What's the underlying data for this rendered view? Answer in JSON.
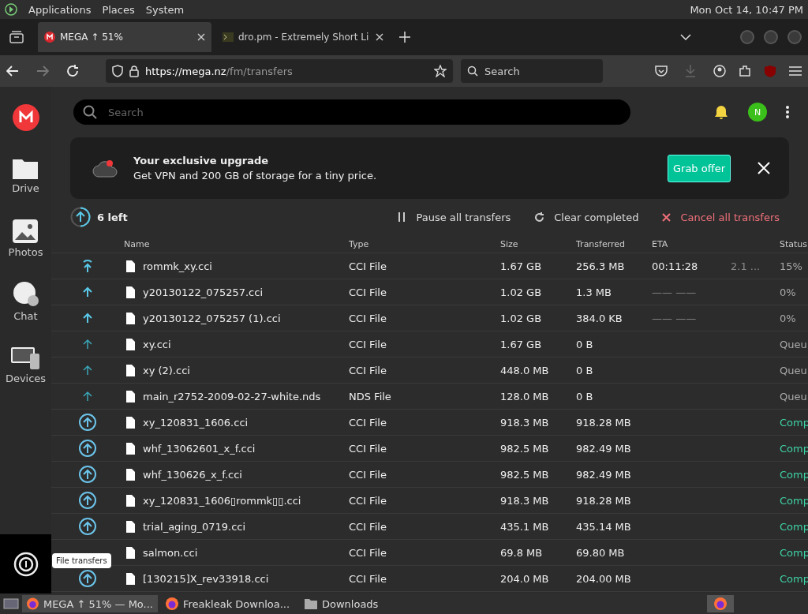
{
  "top_panel": {
    "menus": [
      "Applications",
      "Places",
      "System"
    ],
    "clock": "Mon Oct 14, 10:47 PM"
  },
  "browser": {
    "tabs": [
      {
        "label": "MEGA ↑ 51%",
        "selected": true
      },
      {
        "label": "dro.pm - Extremely Short Li",
        "selected": false
      }
    ],
    "url": {
      "host": "https://mega.nz",
      "path": "/fm/transfers"
    },
    "search": {
      "placeholder": "Search"
    }
  },
  "sidebar": {
    "items": [
      {
        "label": "Drive",
        "kind": "drive"
      },
      {
        "label": "Photos",
        "kind": "photos"
      },
      {
        "label": "Chat",
        "kind": "chat"
      },
      {
        "label": "Devices",
        "kind": "devices"
      }
    ],
    "transfers_selected": true,
    "tooltip": "File transfers"
  },
  "search": {
    "placeholder": "Search"
  },
  "avatar": "N",
  "banner": {
    "title": "Your exclusive upgrade",
    "text": "Get VPN and 200 GB of storage for a tiny price.",
    "button": "Grab offer"
  },
  "toolbar": {
    "left": "6 left",
    "actions": [
      {
        "label": "Pause all transfers",
        "kind": "pause"
      },
      {
        "label": "Clear completed",
        "kind": "clear"
      },
      {
        "label": "Cancel all transfers",
        "kind": "cancel"
      }
    ]
  },
  "table": {
    "columns": [
      "Name",
      "Type",
      "Size",
      "Transferred",
      "ETA",
      "Status"
    ],
    "rows": [
      {
        "kind": "active",
        "name": "rommk_xy.cci",
        "type": "CCI File",
        "size": "1.67 GB",
        "transferred": "256.3 MB",
        "eta": "00:11:28",
        "column_7": "2.1 ...",
        "status": "15%"
      },
      {
        "kind": "paused",
        "name": "y20130122_075257.cci",
        "type": "CCI File",
        "size": "1.02 GB",
        "transferred": "1.3 MB",
        "eta": "—— ——",
        "status": "0%"
      },
      {
        "kind": "paused",
        "name": "y20130122_075257 (1).cci",
        "type": "CCI File",
        "size": "1.02 GB",
        "transferred": "384.0 KB",
        "eta": "—— ——",
        "status": "0%"
      },
      {
        "kind": "queued",
        "name": "xy.cci",
        "type": "CCI File",
        "size": "1.67 GB",
        "transferred": "0 B",
        "status": "Queu"
      },
      {
        "kind": "queued",
        "name": "xy (2).cci",
        "type": "CCI File",
        "size": "448.0 MB",
        "transferred": "0 B",
        "status": "Queu"
      },
      {
        "kind": "queued",
        "name": "main_r2752-2009-02-27-white.nds",
        "type": "NDS File",
        "size": "128.0 MB",
        "transferred": "0 B",
        "status": "Queu"
      },
      {
        "kind": "done",
        "name": "xy_120831_1606.cci",
        "type": "CCI File",
        "size": "918.3 MB",
        "transferred": "918.28 MB",
        "status": "Comp"
      },
      {
        "kind": "done",
        "name": "whf_13062601_x_f.cci",
        "type": "CCI File",
        "size": "982.5 MB",
        "transferred": "982.49 MB",
        "status": "Comp"
      },
      {
        "kind": "done",
        "name": "whf_130626_x_f.cci",
        "type": "CCI File",
        "size": "982.5 MB",
        "transferred": "982.49 MB",
        "status": "Comp"
      },
      {
        "kind": "done",
        "name": "xy_120831_1606▯rommk▯▯.cci",
        "type": "CCI File",
        "size": "918.3 MB",
        "transferred": "918.28 MB",
        "status": "Comp"
      },
      {
        "kind": "done",
        "name": "trial_aging_0719.cci",
        "type": "CCI File",
        "size": "435.1 MB",
        "transferred": "435.14 MB",
        "status": "Comp"
      },
      {
        "kind": "done",
        "icon_hidden": true,
        "name": "salmon.cci",
        "type": "CCI File",
        "size": "69.8 MB",
        "transferred": "69.80 MB",
        "status": "Comp"
      },
      {
        "kind": "done",
        "name": "[130215]X_rev33918.cci",
        "type": "CCI File",
        "size": "204.0 MB",
        "transferred": "204.00 MB",
        "status": "Comp"
      }
    ]
  },
  "taskbar": [
    {
      "label": "MEGA ↑ 51% — Mo...",
      "kind": "browser",
      "selected": true
    },
    {
      "label": "Freakleak Downloa...",
      "kind": "browser",
      "selected": false
    },
    {
      "label": "Downloads",
      "kind": "folder",
      "selected": false
    }
  ]
}
